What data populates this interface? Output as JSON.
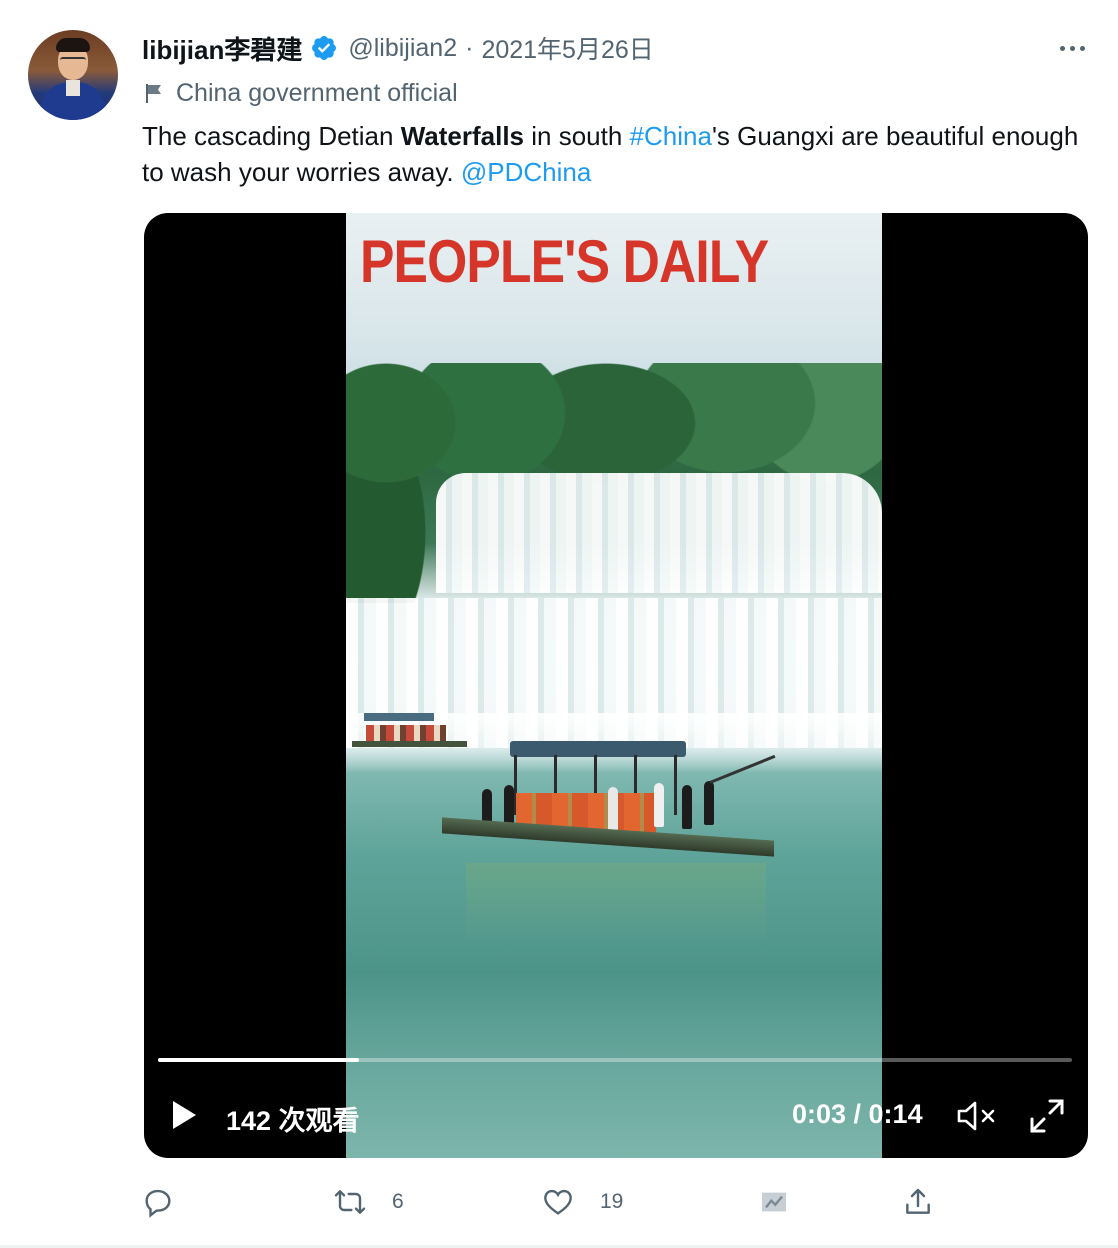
{
  "author": {
    "name": "libijian李碧建",
    "handle": "@libijian2",
    "separator": "·",
    "date": "2021年5月26日",
    "label": "China government official"
  },
  "tweet": {
    "text_part1": "The cascading Detian ",
    "text_bold": "Waterfalls",
    "text_part2": " in south ",
    "hashtag": "#China",
    "text_part3": "'s Guangxi are beautiful enough to wash your worries away. ",
    "mention": "@PDChina"
  },
  "video": {
    "overlay_logo": "PEOPLE'S DAILY",
    "views": "142 次观看",
    "time": "0:03 / 0:14",
    "progress": 0.22
  },
  "actions": {
    "reply_count": "",
    "retweet_count": "6",
    "like_count": "19"
  },
  "colors": {
    "accent": "#1d9bf0",
    "secondary_text": "#536471",
    "logo_red": "#d6352a"
  },
  "icons": [
    "verified-badge-icon",
    "more-icon",
    "flag-icon",
    "play-icon",
    "mute-icon",
    "fullscreen-icon",
    "reply-icon",
    "retweet-icon",
    "like-icon",
    "analytics-icon",
    "share-icon"
  ]
}
